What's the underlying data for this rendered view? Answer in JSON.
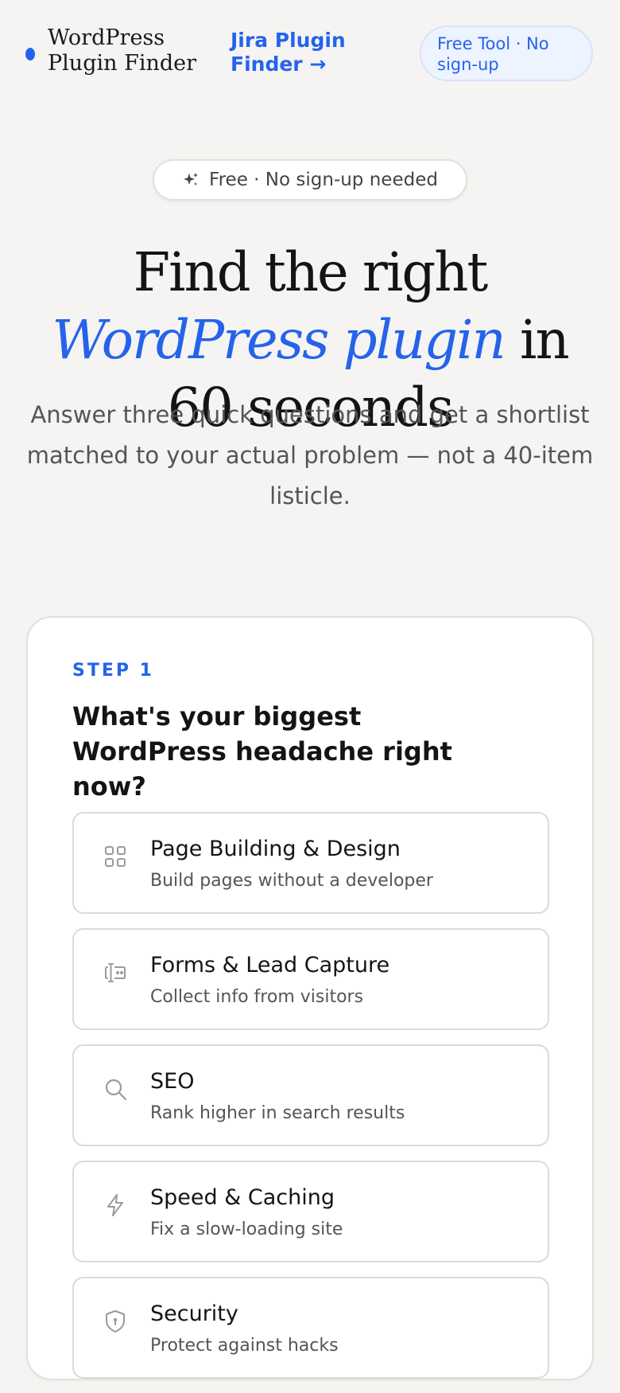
{
  "header": {
    "brand": "WordPress Plugin Finder",
    "nav_link": "Jira Plugin Finder →",
    "pill": "Free Tool · No sign-up"
  },
  "hero": {
    "badge": "Free · No sign-up needed",
    "title_part1": "Find the right ",
    "title_accent": "WordPress plugin",
    "title_part2": " in 60 seconds",
    "subtitle": "Answer three quick questions and get a shortlist matched to your actual problem — not a 40-item listicle."
  },
  "quiz": {
    "step_label": "STEP 1",
    "question": "What's your biggest WordPress headache right now?",
    "options": [
      {
        "title": "Page Building & Design",
        "description": "Build pages without a developer",
        "icon": "grid-icon"
      },
      {
        "title": "Forms & Lead Capture",
        "description": "Collect info from visitors",
        "icon": "form-icon"
      },
      {
        "title": "SEO",
        "description": "Rank higher in search results",
        "icon": "search-icon"
      },
      {
        "title": "Speed & Caching",
        "description": "Fix a slow-loading site",
        "icon": "lightning-icon"
      },
      {
        "title": "Security",
        "description": "Protect against hacks",
        "icon": "shield-icon"
      }
    ]
  },
  "colors": {
    "accent": "#2563eb",
    "background": "#f5f4f2",
    "card": "#ffffff"
  }
}
